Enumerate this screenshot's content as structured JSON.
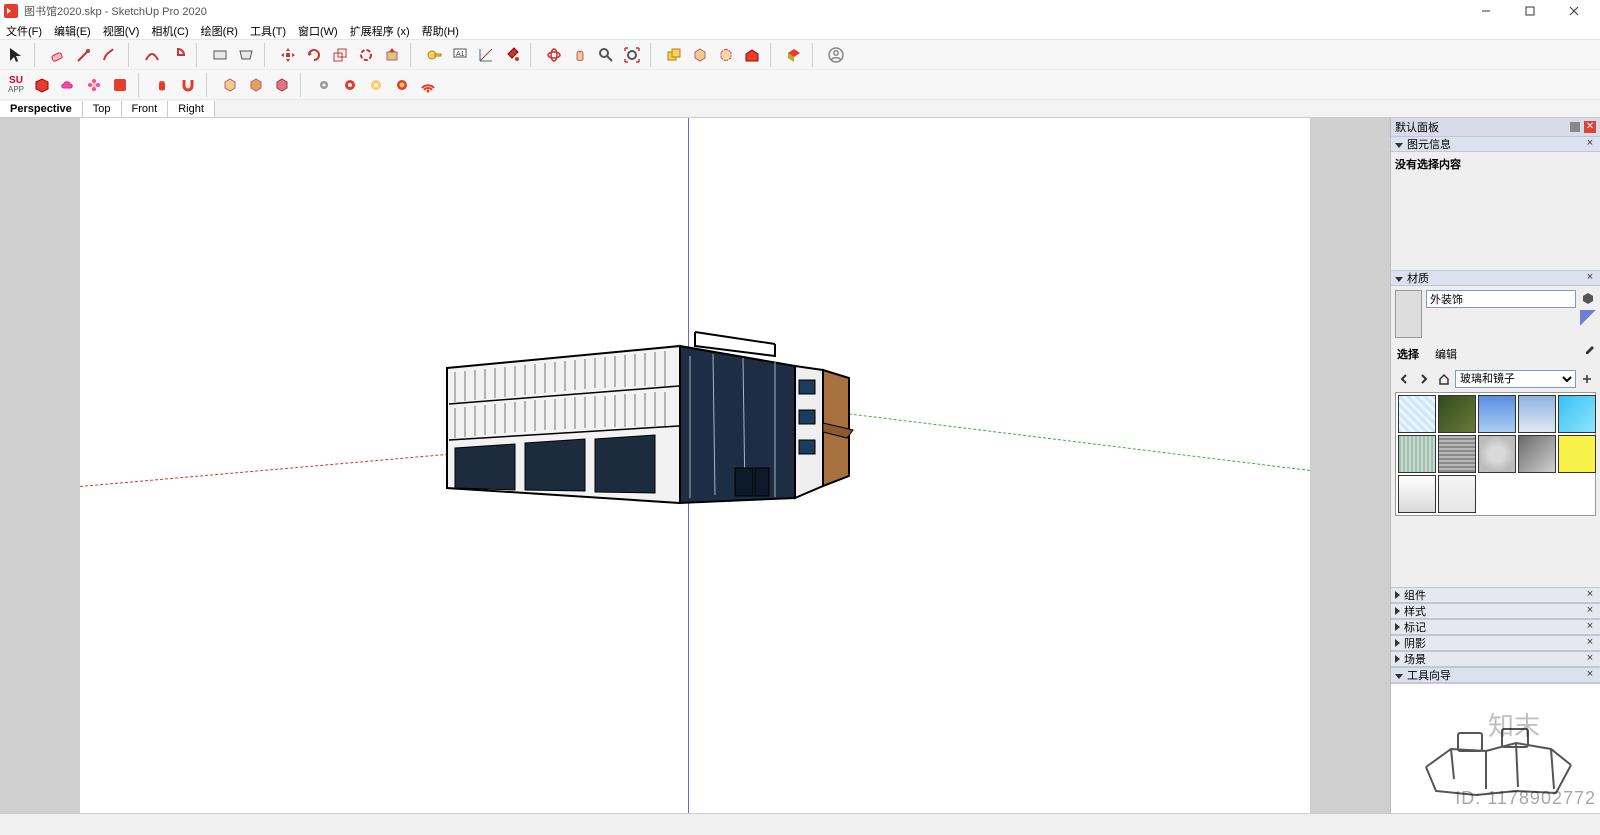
{
  "window": {
    "title": "图书馆2020.skp - SketchUp Pro 2020",
    "controls": {
      "minimize": "—",
      "maximize": "☐",
      "close": "✕"
    }
  },
  "menu": {
    "items": [
      "文件(F)",
      "编辑(E)",
      "视图(V)",
      "相机(C)",
      "绘图(R)",
      "工具(T)",
      "窗口(W)",
      "扩展程序 (x)",
      "帮助(H)"
    ]
  },
  "view_tabs": [
    "Perspective",
    "Top",
    "Front",
    "Right"
  ],
  "active_view_tab": "Perspective",
  "tray": {
    "title": "默认面板",
    "entity_info": {
      "title": "图元信息",
      "message": "没有选择内容"
    },
    "materials": {
      "title": "材质",
      "current_name": "外装饰",
      "tabs": {
        "select": "选择",
        "edit": "编辑"
      },
      "library": "玻璃和镜子"
    },
    "panels": {
      "components": "组件",
      "styles": "样式",
      "tags": "标记",
      "shadows": "阴影",
      "scenes": "场景",
      "instructor": "工具向导"
    }
  },
  "watermark": {
    "brand": "知末",
    "id_label": "ID: 1178902772"
  },
  "toolbar_icons_row1": [
    "select-arrow",
    "eraser",
    "pencil",
    "brush",
    "arc",
    "polygon-arc",
    "rectangle",
    "surface",
    "sep",
    "move",
    "rotate-copy",
    "scale",
    "rotate",
    "offset",
    "push-pull",
    "sep",
    "tape",
    "text-label",
    "protractor",
    "paint-bucket",
    "sep",
    "orbit",
    "pan",
    "zoom",
    "zoom-extents",
    "sep",
    "group",
    "component",
    "ungroup",
    "red-cube",
    "sep",
    "red-gem",
    "sep",
    "user-circle"
  ],
  "toolbar_icons_row2": [
    "su-app",
    "package",
    "cloud",
    "flower",
    "red-box",
    "sep",
    "hand",
    "magnet",
    "sep",
    "cube-a",
    "cube-b",
    "cube-c",
    "sep",
    "gear-cloud",
    "red-gear",
    "donut",
    "red-donut",
    "wifi"
  ]
}
